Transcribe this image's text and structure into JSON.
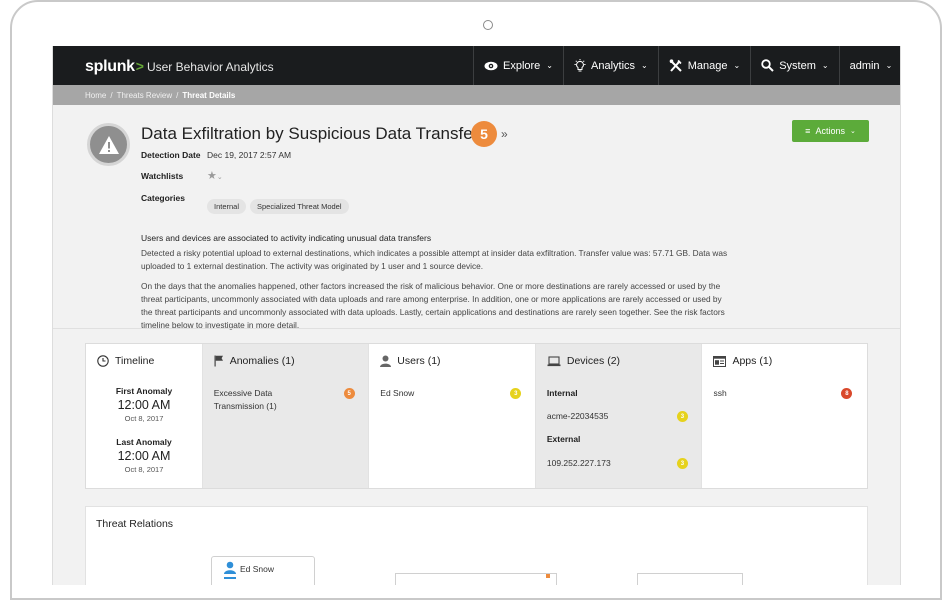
{
  "nav": {
    "brand_logo": "splunk",
    "brand_sep": ">",
    "brand_product": "User Behavior Analytics",
    "items": [
      {
        "label": "Explore",
        "icon": "eye-icon"
      },
      {
        "label": "Analytics",
        "icon": "lightbulb-icon"
      },
      {
        "label": "Manage",
        "icon": "tools-icon"
      },
      {
        "label": "System",
        "icon": "search-icon"
      },
      {
        "label": "admin",
        "icon": ""
      }
    ]
  },
  "breadcrumb": {
    "home": "Home",
    "sep": "/",
    "threats": "Threats Review",
    "current": "Threat Details"
  },
  "threat": {
    "title": "Data Exfiltration by Suspicious Data Transfer",
    "score": "5",
    "score_color": "#ed8b3d",
    "expand_glyph": "»",
    "actions_label": "Actions",
    "actions_color": "#5cab3a",
    "detection_label": "Detection Date",
    "detection_value": "Dec 19, 2017 2:57 AM",
    "watchlists_label": "Watchlists",
    "categories_label": "Categories",
    "categories": [
      "Internal",
      "Specialized Threat Model"
    ],
    "summary": "Users and devices are associated to activity indicating unusual data transfers",
    "desc_lines_1": [
      "Detected a risky potential upload to external destinations, which indicates a possible attempt at insider data exfiltration. Transfer value was: 57.71 GB. Data was",
      "uploaded to 1 external destination. The activity was originated by 1 user and 1 source device."
    ],
    "desc_lines_2": [
      "On the days that the anomalies happened, other factors increased the risk of malicious behavior. One or more destinations are rarely accessed or used by the",
      "threat participants, uncommonly associated with data uploads and rare among enterprise. In addition, one or more applications are rarely accessed or used by",
      "the threat participants and uncommonly associated with data uploads. Lastly, certain applications and destinations are rarely seen together. See the risk factors",
      "timeline below to investigate in more detail."
    ]
  },
  "timeline": {
    "title": "Timeline",
    "first_label": "First Anomaly",
    "first_time": "12:00 AM",
    "first_date": "Oct 8, 2017",
    "last_label": "Last Anomaly",
    "last_time": "12:00 AM",
    "last_date": "Oct 8, 2017"
  },
  "anomalies": {
    "title": "Anomalies",
    "count": "(1)",
    "item_line1": "Excessive Data",
    "item_line2": "Transmission  (1)",
    "badge": "5",
    "badge_color": "#ed8b3d"
  },
  "users": {
    "title": "Users",
    "count": "(1)",
    "item": "Ed Snow",
    "badge": "3",
    "badge_color": "#e6d21c"
  },
  "devices": {
    "title": "Devices",
    "count": "(2)",
    "internal_label": "Internal",
    "internal_item": "acme-22034535",
    "internal_badge": "3",
    "external_label": "External",
    "external_item": "109.252.227.173",
    "external_badge": "3",
    "badge_color": "#e6d21c"
  },
  "apps": {
    "title": "Apps",
    "count": "(1)",
    "item": "ssh",
    "badge": "8",
    "badge_color": "#d9482b"
  },
  "relations": {
    "title": "Threat Relations",
    "node_user": "Ed Snow"
  }
}
